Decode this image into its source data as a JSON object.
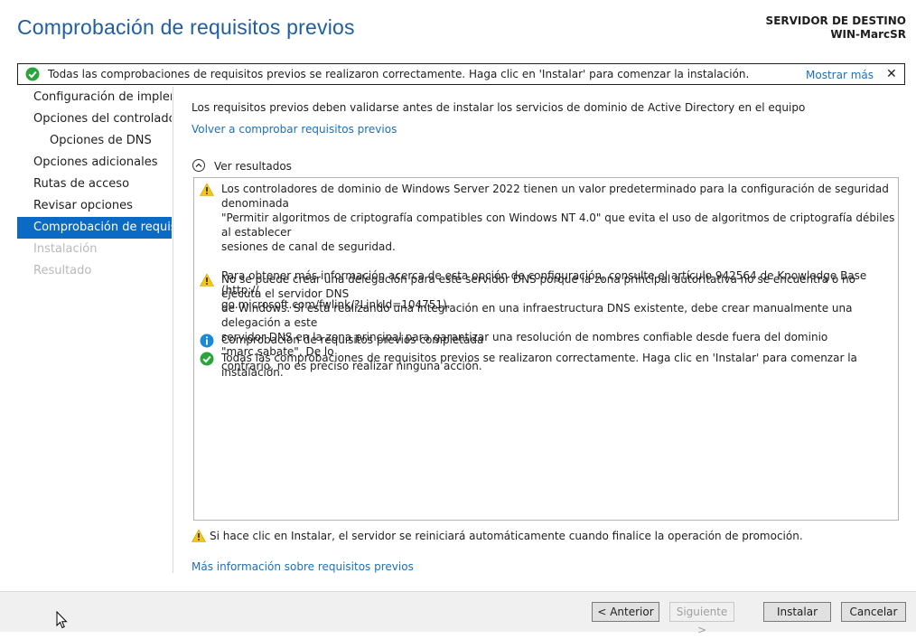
{
  "window": {
    "title": "Comprobación de requisitos previos",
    "destination_label": "SERVIDOR DE DESTINO",
    "destination_server": "WIN-MarcSR"
  },
  "banner": {
    "text": "Todas las comprobaciones de requisitos previos se realizaron correctamente. Haga clic en 'Instalar' para comenzar la instalación.",
    "more_link": "Mostrar más",
    "close_glyph": "✕",
    "icon": "check-circle-icon",
    "icon_color": "#2aa53b"
  },
  "sidebar": {
    "items": [
      {
        "label": "Configuración de implem..."
      },
      {
        "label": "Opciones del controlador..."
      },
      {
        "label": "Opciones de DNS"
      },
      {
        "label": "Opciones adicionales"
      },
      {
        "label": "Rutas de acceso"
      },
      {
        "label": "Revisar opciones"
      },
      {
        "label": "Comprobación de requisi..."
      },
      {
        "label": "Instalación"
      },
      {
        "label": "Resultado"
      }
    ],
    "active_color": "#0a6ac4"
  },
  "main": {
    "intro": "Los requisitos previos deben validarse antes de instalar los servicios de dominio de Active Directory en el equipo",
    "recheck_link": "Volver a comprobar requisitos previos",
    "view_results_label": "Ver resultados",
    "results": [
      {
        "icon": "warning-icon",
        "text": "Los controladores de dominio de Windows Server 2022 tienen un valor predeterminado para la configuración de seguridad denominada\n\"Permitir algoritmos de criptografía compatibles con Windows NT 4.0\" que evita el uso de algoritmos de criptografía débiles al establecer\nsesiones de canal de seguridad.\n\nPara obtener más información acerca de esta opción de configuración, consulte el artículo 942564 de Knowledge Base (http://\ngo.microsoft.com/fwlink/?LinkId=104751)."
      },
      {
        "icon": "warning-icon",
        "text": "No se puede crear una delegación para este servidor DNS porque la zona principal autoritativa no se encuentra o no ejecuta el servidor DNS\nde Windows. Si está realizando una integración en una infraestructura DNS existente, debe crear manualmente una delegación a este\nservidor DNS en la zona principal para garantizar una resolución de nombres confiable desde fuera del dominio \"marc.sabate\". De lo\ncontrario, no es preciso realizar ninguna acción."
      },
      {
        "icon": "info-icon",
        "text": "Comprobación de requisitos previos completada"
      },
      {
        "icon": "check-circle-icon",
        "text": "Todas las comprobaciones de requisitos previos se realizaron correctamente. Haga clic en 'Instalar' para comenzar la instalación."
      }
    ],
    "footer_warning": "Si hace clic en Instalar, el servidor se reiniciará automáticamente cuando finalice la operación de promoción.",
    "more_info_link": "Más información sobre requisitos previos"
  },
  "buttons": {
    "previous": "< Anterior",
    "next": "Siguiente >",
    "install": "Instalar",
    "cancel": "Cancelar"
  },
  "colors": {
    "title": "#1f5fa0",
    "link": "#1e6fb5",
    "warning": "#f5c518",
    "info": "#1a8ad4",
    "success": "#2aa53b"
  }
}
